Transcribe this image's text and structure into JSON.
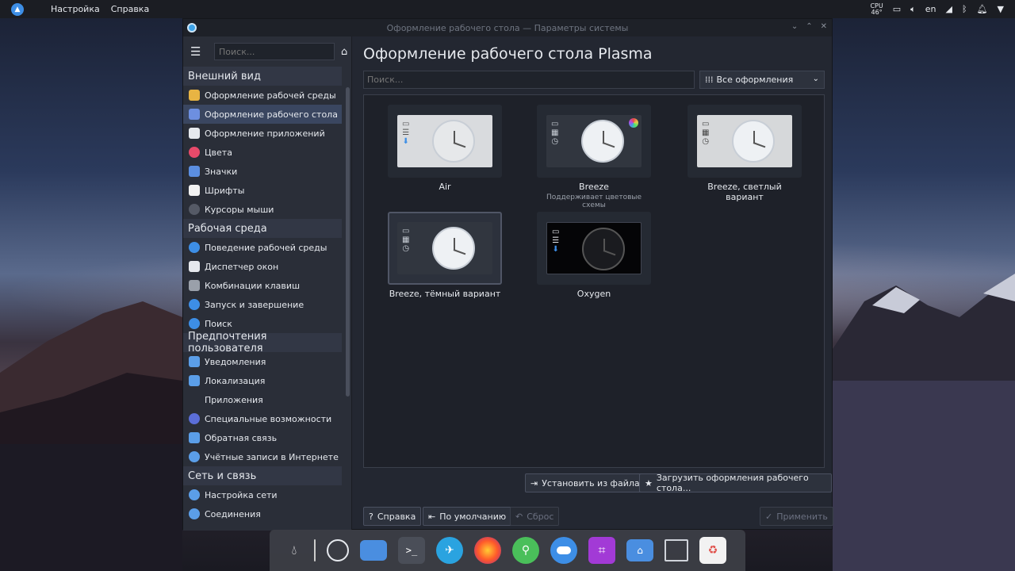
{
  "panel": {
    "launcher_icon": "plasma-arrow-icon",
    "menus": [
      "Настройка",
      "Справка"
    ],
    "cpu_label": "CPU",
    "cpu_temp": "46°",
    "keyboard_layout": "en"
  },
  "window": {
    "title": "Оформление рабочего стола — Параметры системы",
    "buttons": [
      "⌄",
      "⌃",
      "✕"
    ]
  },
  "sidebar": {
    "search_placeholder": "Поиск...",
    "sections": [
      {
        "title": "Внешний вид",
        "items": [
          {
            "label": "Оформление рабочей среды",
            "icon": "global-theme-icon",
            "color": "#e8b443"
          },
          {
            "label": "Оформление рабочего стола",
            "icon": "desktop-theme-icon",
            "color": "#6d8fe0",
            "selected": true
          },
          {
            "label": "Оформление приложений",
            "icon": "app-style-icon",
            "color": "#e6e9ee"
          },
          {
            "label": "Цвета",
            "icon": "colors-icon",
            "color": "#e84a6a"
          },
          {
            "label": "Значки",
            "icon": "icons-icon",
            "color": "#5b8ee0"
          },
          {
            "label": "Шрифты",
            "icon": "fonts-icon",
            "color": "#f2f2f2"
          },
          {
            "label": "Курсоры мыши",
            "icon": "cursor-icon",
            "color": "#555a66"
          }
        ]
      },
      {
        "title": "Рабочая среда",
        "items": [
          {
            "label": "Поведение рабочей среды",
            "icon": "workspace-behavior-icon",
            "color": "#3d8ee6"
          },
          {
            "label": "Диспетчер окон",
            "icon": "window-manager-icon",
            "color": "#e6e9ee"
          },
          {
            "label": "Комбинации клавиш",
            "icon": "keyboard-icon",
            "color": "#9aa0aa"
          },
          {
            "label": "Запуск и завершение",
            "icon": "startup-icon",
            "color": "#3d8ee6"
          },
          {
            "label": "Поиск",
            "icon": "search-config-icon",
            "color": "#3d8ee6"
          }
        ]
      },
      {
        "title": "Предпочтения пользователя",
        "items": [
          {
            "label": "Уведомления",
            "icon": "notifications-icon",
            "color": "#5b9ee8"
          },
          {
            "label": "Локализация",
            "icon": "localization-icon",
            "color": "#5b9ee8"
          },
          {
            "label": "Приложения",
            "icon": "applications-icon",
            "color": "#2a2e38"
          },
          {
            "label": "Специальные возможности",
            "icon": "accessibility-icon",
            "color": "#5b6ed8"
          },
          {
            "label": "Обратная связь",
            "icon": "feedback-icon",
            "color": "#5b9ee8"
          },
          {
            "label": "Учётные записи в Интернете",
            "icon": "online-accounts-icon",
            "color": "#5b9ee8"
          }
        ]
      },
      {
        "title": "Сеть и связь",
        "items": [
          {
            "label": "Настройка сети",
            "icon": "network-settings-icon",
            "color": "#5b9ee8"
          },
          {
            "label": "Соединения",
            "icon": "connections-icon",
            "color": "#5b9ee8"
          }
        ]
      }
    ]
  },
  "main": {
    "title": "Оформление рабочего стола Plasma",
    "search_placeholder": "Поиск...",
    "filter_label": "Все оформления",
    "themes": [
      {
        "name": "Air",
        "subtitle": "",
        "style": "air"
      },
      {
        "name": "Breeze",
        "subtitle": "Поддерживает цветовые схемы",
        "style": "breeze"
      },
      {
        "name": "Breeze, светлый вариант",
        "subtitle": "",
        "style": "light"
      },
      {
        "name": "Breeze, тёмный вариант",
        "subtitle": "",
        "style": "dark",
        "selected": true
      },
      {
        "name": "Oxygen",
        "subtitle": "",
        "style": "oxygen"
      }
    ],
    "install_from_file": "Установить из файла...",
    "get_new": "Загрузить оформления рабочего стола...",
    "help": "Справка",
    "defaults": "По умолчанию",
    "reset": "Сброс",
    "apply": "Применить"
  },
  "dock": {
    "icons": [
      "droplet-icon",
      "circle-icon",
      "folder-icon",
      "terminal-icon",
      "telegram-icon",
      "firefox-icon",
      "keepass-icon",
      "toggle-icon",
      "crop-icon",
      "home-folder-icon",
      "window-icon",
      "trash-icon"
    ]
  }
}
